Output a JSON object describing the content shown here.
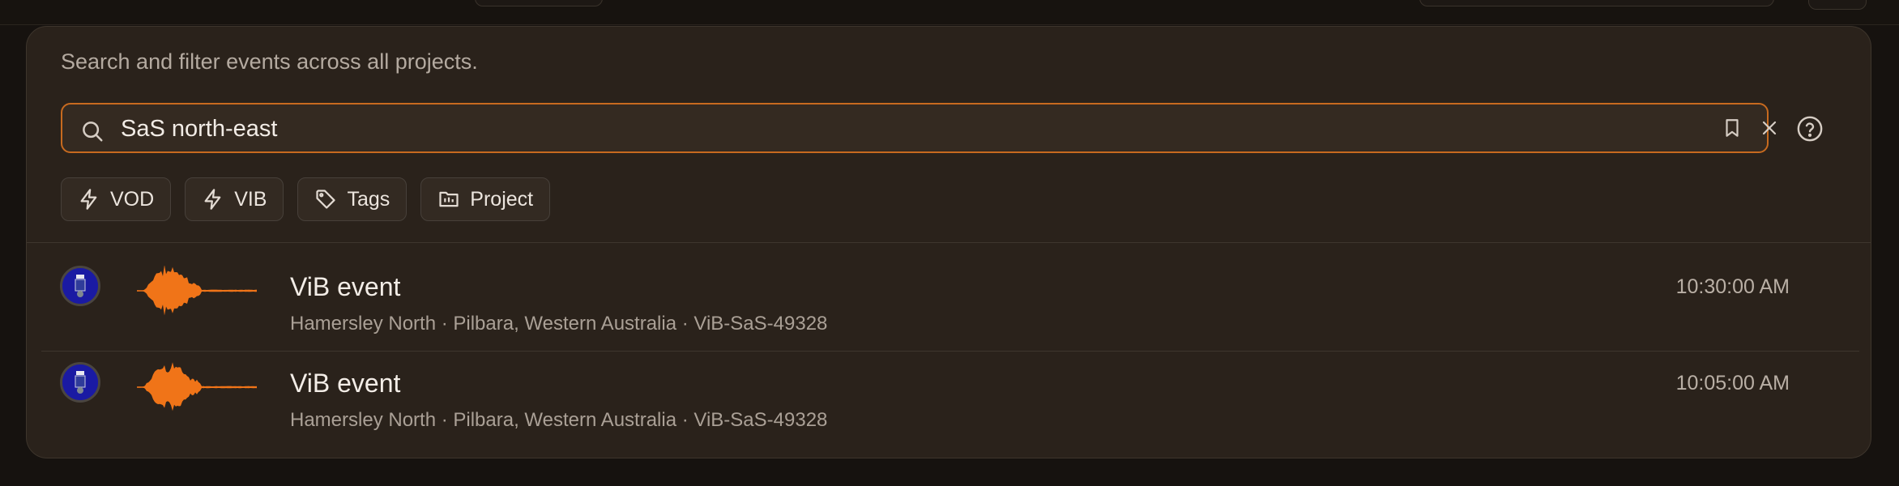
{
  "panel": {
    "description": "Search and filter events across all projects."
  },
  "search": {
    "value": "SaS north-east"
  },
  "filters": [
    {
      "label": "VOD",
      "icon": "lightning-icon"
    },
    {
      "label": "VIB",
      "icon": "lightning-icon"
    },
    {
      "label": "Tags",
      "icon": "tag-icon"
    },
    {
      "label": "Project",
      "icon": "folder-icon"
    }
  ],
  "results": [
    {
      "title": "ViB event",
      "subtitle": "Hamersley North · Pilbara, Western Australia · ViB-SaS-49328",
      "time": "10:30:00 AM"
    },
    {
      "title": "ViB event",
      "subtitle": "Hamersley North · Pilbara, Western Australia · ViB-SaS-49328",
      "time": "10:05:00 AM"
    }
  ],
  "colors": {
    "accent": "#c76a1f",
    "waveform": "#f07418",
    "panel_bg": "#2a221b",
    "avatar_bg": "#1a1aa3"
  }
}
